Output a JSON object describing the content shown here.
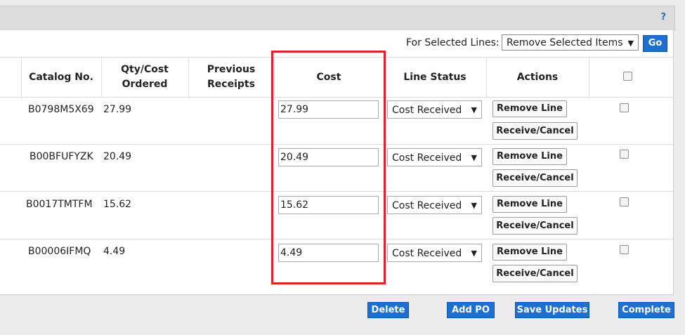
{
  "help_label": "?",
  "bulk": {
    "label": "For Selected Lines:",
    "selected": "Remove Selected Items",
    "go_label": "Go"
  },
  "columns": {
    "catalog": "Catalog No.",
    "qty": "Qty/Cost Ordered",
    "receipts": "Previous Receipts",
    "cost": "Cost",
    "status": "Line Status",
    "actions": "Actions"
  },
  "rows": [
    {
      "catalog": "B0798M5X69",
      "qty": "27.99",
      "cost": "27.99",
      "status": "Cost Received",
      "remove": "Remove Line",
      "receive": "Receive/Cancel"
    },
    {
      "catalog": "B00BFUFYZK",
      "qty": "20.49",
      "cost": "20.49",
      "status": "Cost Received",
      "remove": "Remove Line",
      "receive": "Receive/Cancel"
    },
    {
      "catalog": "B0017TMTFM",
      "qty": "15.62",
      "cost": "15.62",
      "status": "Cost Received",
      "remove": "Remove Line",
      "receive": "Receive/Cancel"
    },
    {
      "catalog": "B00006IFMQ",
      "qty": "4.49",
      "cost": "4.49",
      "status": "Cost Received",
      "remove": "Remove Line",
      "receive": "Receive/Cancel"
    }
  ],
  "footer": {
    "delete": "Delete",
    "add_po": "Add PO",
    "save": "Save Updates",
    "complete": "Complete"
  },
  "colors": {
    "accent": "#1d6fd0",
    "highlight": "#d6262b"
  }
}
